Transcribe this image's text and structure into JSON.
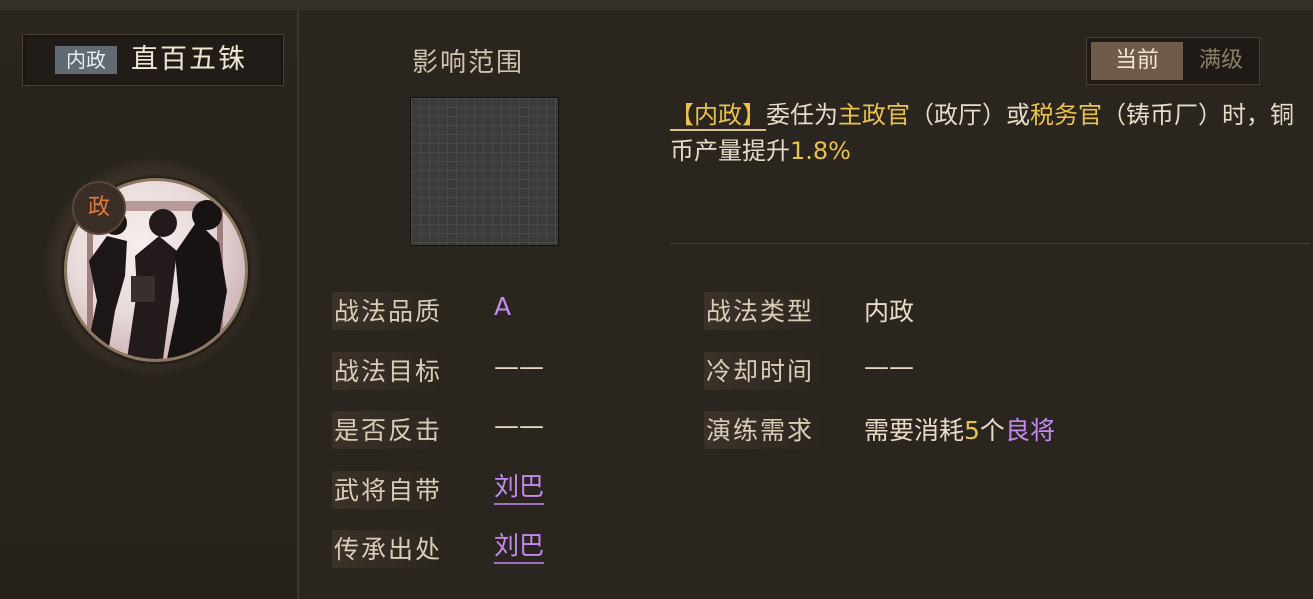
{
  "skill": {
    "type_badge": "内政",
    "name": "直百五铢",
    "portrait_badge": "政"
  },
  "range": {
    "label": "影响范围"
  },
  "level_toggle": {
    "current": "当前",
    "max": "满级"
  },
  "description": {
    "tag": "【内政】",
    "p1": "委任为",
    "role1": "主政官",
    "p2": "（政厅）或",
    "role2": "税务官",
    "p3": "（铸币厂）时，铜币产量提升",
    "percent": "1.8%"
  },
  "info": {
    "quality": {
      "label": "战法品质",
      "value": "A"
    },
    "target": {
      "label": "战法目标",
      "value": "——"
    },
    "counter": {
      "label": "是否反击",
      "value": "——"
    },
    "general": {
      "label": "武将自带",
      "value": "刘巴"
    },
    "origin": {
      "label": "传承出处",
      "value": "刘巴"
    },
    "type": {
      "label": "战法类型",
      "value": "内政"
    },
    "cooldown": {
      "label": "冷却时间",
      "value": "——"
    },
    "drill": {
      "label": "演练需求",
      "prefix": "需要消耗",
      "count": "5",
      "unit": "个",
      "item": "良将"
    }
  },
  "colors": {
    "highlight_yellow": "#e9c24d",
    "quality_purple": "#c38af0",
    "badge_orange": "#e07a3f"
  }
}
